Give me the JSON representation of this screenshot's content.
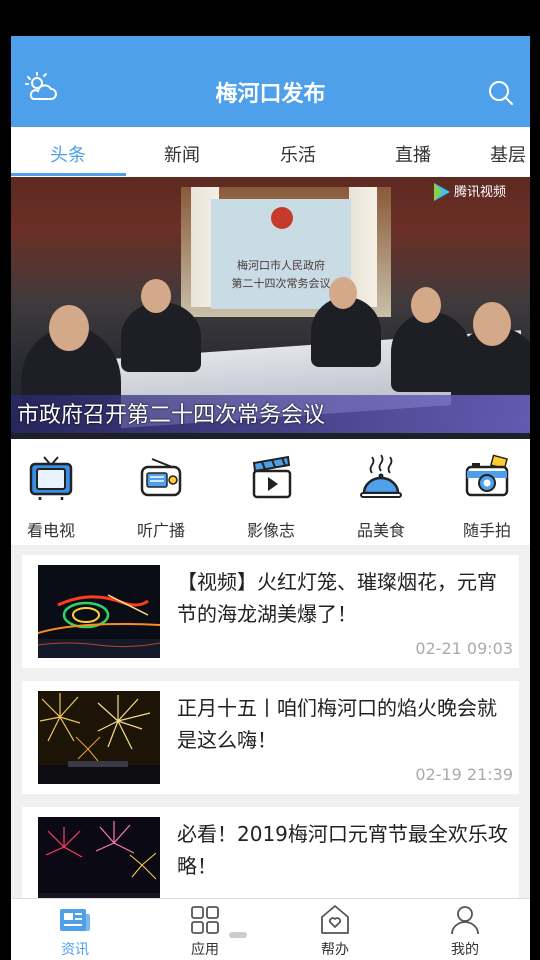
{
  "header": {
    "title": "梅河口发布"
  },
  "tabs": [
    {
      "label": "头条",
      "active": true
    },
    {
      "label": "新闻"
    },
    {
      "label": "乐活"
    },
    {
      "label": "直播"
    },
    {
      "label": "基层"
    }
  ],
  "banner": {
    "caption": "市政府召开第二十四次常务会议",
    "screen_line1": "梅河口市人民政府",
    "screen_line2": "第二十四次常务会议",
    "logo_text": "腾讯视频"
  },
  "shortcuts": [
    {
      "label": "看电视",
      "icon": "tv-icon"
    },
    {
      "label": "听广播",
      "icon": "radio-icon"
    },
    {
      "label": "影像志",
      "icon": "video-clapper-icon"
    },
    {
      "label": "品美食",
      "icon": "food-cloche-icon"
    },
    {
      "label": "随手拍",
      "icon": "camera-icon"
    }
  ],
  "news": [
    {
      "title": "【视频】火红灯笼、璀璨烟花，元宵节的海龙湖美爆了！",
      "time": "02-21 09:03"
    },
    {
      "title": "正月十五丨咱们梅河口的焰火晚会就是这么嗨！",
      "time": "02-19 21:39"
    },
    {
      "title": "必看！2019梅河口元宵节最全欢乐攻略！",
      "time": ""
    }
  ],
  "bottom_nav": [
    {
      "label": "资讯",
      "icon": "news-icon",
      "active": true
    },
    {
      "label": "应用",
      "icon": "apps-grid-icon"
    },
    {
      "label": "帮办",
      "icon": "help-house-icon"
    },
    {
      "label": "我的",
      "icon": "profile-icon"
    }
  ],
  "colors": {
    "accent": "#4ea0ea",
    "background": "#f0f0f0"
  }
}
